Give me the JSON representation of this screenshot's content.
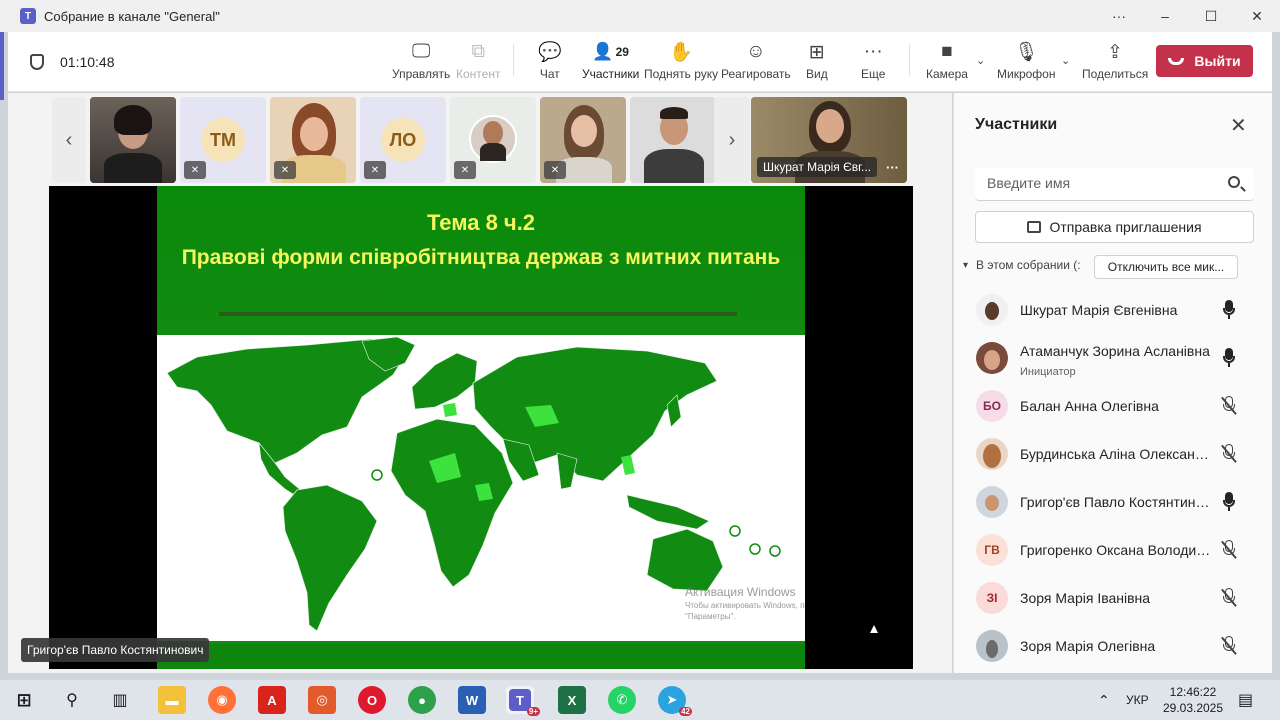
{
  "window": {
    "title": "Собрание в канале \"General\"",
    "controls": [
      "···",
      "–",
      "☐",
      "✕"
    ]
  },
  "toolbar": {
    "timer": "01:10:48",
    "items": {
      "manage": "Управлять",
      "content": "Контент",
      "chat": "Чат",
      "participants": "Участники",
      "participants_count": "29",
      "raise_hand": "Поднять руку",
      "react": "Реагировать",
      "view": "Вид",
      "more": "Еще",
      "camera": "Камера",
      "mic": "Микрофон",
      "share": "Поделиться"
    },
    "leave": "Выйти"
  },
  "video_strip": {
    "tiles": [
      {
        "initials": ""
      },
      {
        "initials": "ТМ"
      },
      {
        "initials": ""
      },
      {
        "initials": "ЛО"
      },
      {
        "initials": ""
      },
      {
        "initials": ""
      },
      {
        "initials": ""
      }
    ],
    "featured_name": "Шкурат Марія Євг..."
  },
  "slide": {
    "title_line1": "Тема 8 ч.2",
    "title_line2": "Правові форми співробітництва держав з митних питань",
    "watermark_title": "Активация Windows",
    "watermark_body": "Чтобы активировать Windows, перейдите в раздел \"Параметры\"."
  },
  "presenter": "Григор'єв Павло Костянтинович",
  "panel": {
    "title": "Участники",
    "search_placeholder": "Введите имя",
    "invite": "Отправка приглашения",
    "section": "В этом собрании (:",
    "mute_all": "Отключить все мик...",
    "participants": [
      {
        "name": "Шкурат Марія Євгенівна",
        "role": "",
        "initials": "",
        "mic": "on"
      },
      {
        "name": "Атаманчук Зорина Асланівна",
        "role": "Инициатор",
        "initials": "",
        "mic": "on"
      },
      {
        "name": "Балан Анна Олегівна",
        "role": "",
        "initials": "БО",
        "mic": "off"
      },
      {
        "name": "Бурдинська Аліна Олександрівна",
        "role": "",
        "initials": "",
        "mic": "off"
      },
      {
        "name": "Григор'єв Павло Костянтинович",
        "role": "",
        "initials": "",
        "mic": "on"
      },
      {
        "name": "Григоренко Оксана Володимирівна",
        "role": "",
        "initials": "ГВ",
        "mic": "off"
      },
      {
        "name": "Зоря Марія Іванівна",
        "role": "",
        "initials": "ЗІ",
        "mic": "off"
      },
      {
        "name": "Зоря Марія Олегівна",
        "role": "",
        "initials": "",
        "mic": "off"
      }
    ]
  },
  "taskbar": {
    "language": "УКР",
    "time": "12:46:22",
    "date": "29.03.2025",
    "teams_badge": "9+",
    "telegram_badge": "42"
  },
  "colors": {
    "accent": "#5b5fc7",
    "leave": "#c4314b",
    "slide_green": "#118b11",
    "slide_title": "#f6f65e"
  }
}
